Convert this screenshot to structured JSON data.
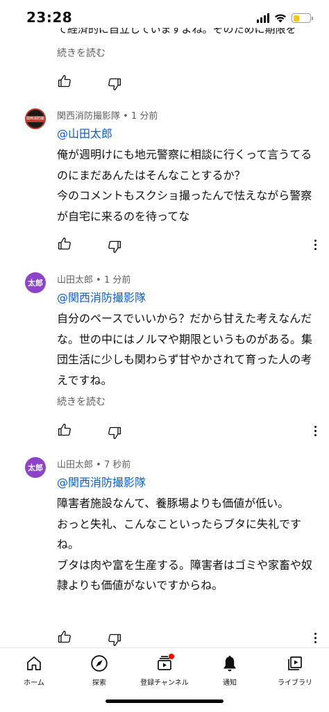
{
  "status_bar": {
    "time": "23:28",
    "battery_level": 0.35
  },
  "feed": {
    "cut_off_text": "て経済的に自立していますよね。そのために期限を",
    "first_read_more": "続きを読む",
    "comments": [
      {
        "author": "関西消防撮影隊",
        "time": "1 分前",
        "separator": "•",
        "avatar_text": "関西消防撮影隊",
        "mention": "@山田太郎",
        "lines": [
          "俺が週明けにも地元警察に相談に行くって言うてる",
          "のにまだあんたはそんなことするか？",
          "今のコメントもスクショ撮ったんで怯えながら警察",
          "が自宅に来るのを待ってな"
        ]
      },
      {
        "author": "山田太郎",
        "time": "1 分前",
        "separator": "•",
        "avatar_text": "太郎",
        "mention": "@関西消防撮影隊",
        "lines": [
          "自分のペースでいいから？だから甘えた考えなんだ",
          "な。世の中にはノルマや期限というものがある。集",
          "団生活に少しも関わらず甘やかされて育った人の考",
          "えですね。"
        ],
        "read_more": "続きを読む"
      },
      {
        "author": "山田太郎",
        "time": "7 秒前",
        "separator": "•",
        "avatar_text": "太郎",
        "mention": "@関西消防撮影隊",
        "lines": [
          "障害者施設なんて、養豚場よりも価値が低い。",
          "おっと失礼、こんなこといったらブタに失礼です",
          "ね。",
          "ブタは肉や富を生産する。障害者はゴミや家畜や奴",
          "隷よりも価値がないですからね。"
        ]
      }
    ]
  },
  "bottom_nav": {
    "items": [
      {
        "label": "ホーム",
        "icon": "home-icon"
      },
      {
        "label": "探索",
        "icon": "compass-icon"
      },
      {
        "label": "登録チャンネル",
        "icon": "subscriptions-icon"
      },
      {
        "label": "通知",
        "icon": "bell-icon"
      },
      {
        "label": "ライブラリ",
        "icon": "library-icon"
      }
    ]
  },
  "colors": {
    "mention": "#065fd4",
    "meta": "#606060",
    "avatar_user": "#8e44c7",
    "accent_red": "#ff0000"
  }
}
